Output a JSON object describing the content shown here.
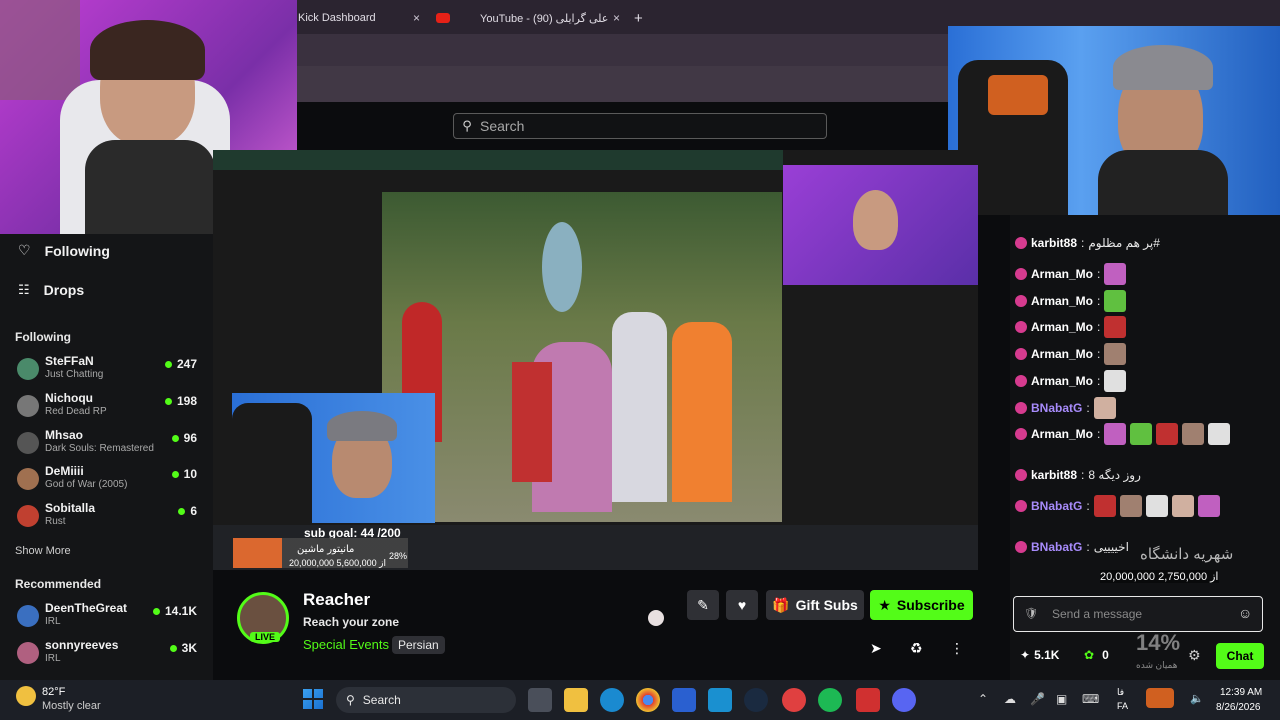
{
  "browser": {
    "tabs": [
      {
        "label": "Kick Dashboard",
        "close": "×"
      },
      {
        "label": "YouTube - علی گرایلی (90)",
        "close": "×"
      }
    ],
    "new_tab": "+",
    "window_controls": [
      "—",
      "☐",
      "✕"
    ]
  },
  "header": {
    "search_placeholder": "Search"
  },
  "sidebar": {
    "nav": [
      {
        "label": "Following",
        "icon": "heart-icon"
      },
      {
        "label": "Drops",
        "icon": "drops-icon"
      }
    ],
    "following_title": "Following",
    "following": [
      {
        "name": "SteFFaN",
        "category": "Just Chatting",
        "viewers": "247",
        "color": "#4a8a6a"
      },
      {
        "name": "Nichoqu",
        "category": "Red Dead RP",
        "viewers": "198",
        "color": "#777777"
      },
      {
        "name": "Mhsao",
        "category": "Dark Souls: Remastered",
        "viewers": "96",
        "color": "#555555"
      },
      {
        "name": "DeMiiii",
        "category": "God of War (2005)",
        "viewers": "10",
        "color": "#a07050"
      },
      {
        "name": "Sobitalla",
        "category": "Rust",
        "viewers": "6",
        "color": "#c04030"
      }
    ],
    "show_more": "Show More",
    "recommended_title": "Recommended",
    "recommended": [
      {
        "name": "DeenTheGreat",
        "category": "IRL",
        "viewers": "14.1K",
        "color": "#3a6fc0"
      },
      {
        "name": "sonnyreeves",
        "category": "IRL",
        "viewers": "3K",
        "color": "#b06080"
      }
    ]
  },
  "video": {
    "overlay_sub_goal": "sub goal: 44 /200",
    "overlay_donation_title": "مانیتور ماشین",
    "overlay_donation_amount": "20,000,000 از 5,600,000",
    "overlay_donation_percent": "28%"
  },
  "stream": {
    "streamer": "Reacher",
    "title": "Reach your zone",
    "category": "Special Events",
    "tag": "Persian",
    "live_badge": "LIVE",
    "gift_subs": "Gift Subs",
    "subscribe": "Subscribe"
  },
  "chat": {
    "messages": [
      {
        "user": "karbit88",
        "text": "پر هم مظلوم#",
        "color": "#ffffff"
      },
      {
        "user": "Arman_Mo",
        "text": "",
        "color": "#ffffff"
      },
      {
        "user": "Arman_Mo",
        "text": "",
        "color": "#ffffff"
      },
      {
        "user": "Arman_Mo",
        "text": "",
        "color": "#ffffff"
      },
      {
        "user": "Arman_Mo",
        "text": "",
        "color": "#ffffff"
      },
      {
        "user": "Arman_Mo",
        "text": "",
        "color": "#ffffff"
      },
      {
        "user": "BNabatG",
        "text": "",
        "color": "#a78bfa"
      },
      {
        "user": "Arman_Mo",
        "text": "",
        "color": "#ffffff"
      },
      {
        "user": "karbit88",
        "text": "روز دیگه 8",
        "color": "#ffffff"
      },
      {
        "user": "BNabatG",
        "text": "",
        "color": "#a78bfa"
      },
      {
        "user": "BNabatG",
        "text": "اخییییی",
        "color": "#a78bfa"
      }
    ],
    "overlay_goal_title": "شهریه دانشگاه",
    "overlay_goal_amount": "20,000,000 از 2,750,000",
    "overlay_percent": "14%",
    "overlay_caption": "همیان شده",
    "input_placeholder": "Send a message",
    "points": "5.1K",
    "kicks": "0",
    "chat_button": "Chat"
  },
  "taskbar": {
    "weather_temp": "82°F",
    "weather_desc": "Mostly clear",
    "search_label": "Search",
    "lang_top": "فا",
    "lang_bottom": "FA",
    "time": "12:39 AM",
    "date": "8/26/2026"
  },
  "colors": {
    "kick_green": "#53fc18",
    "accent_purple": "#a78bfa"
  }
}
